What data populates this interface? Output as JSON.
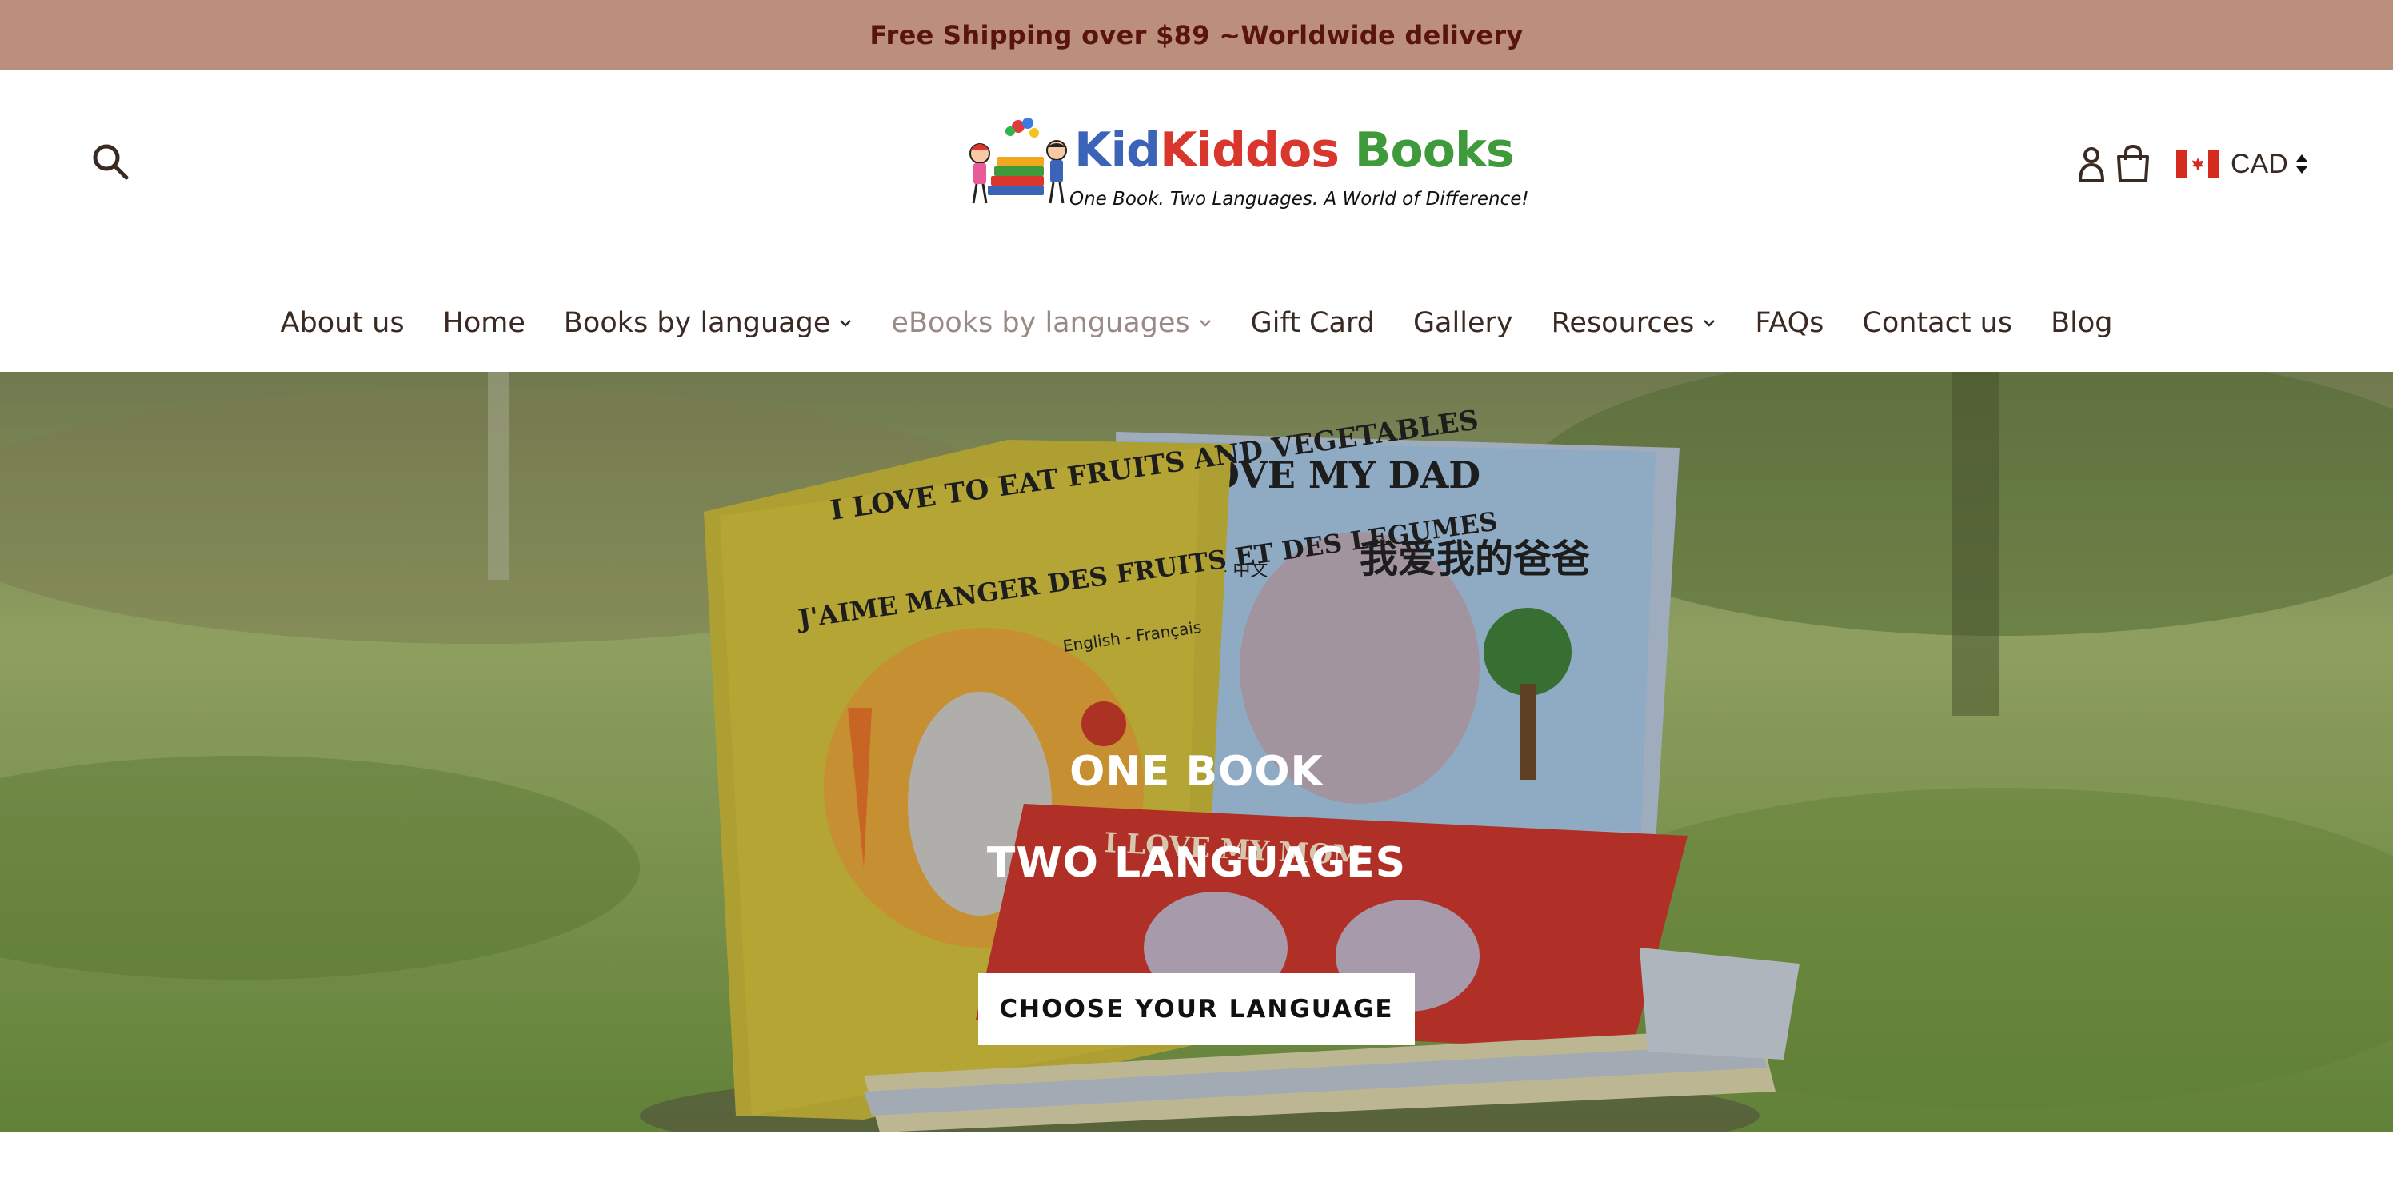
{
  "announcement": {
    "text": "Free Shipping over $89 ~Worldwide delivery"
  },
  "header": {
    "logo": {
      "title_part1": "Kid",
      "title_part2": "Kiddos",
      "title_part3": " Books",
      "tagline": "One Book. Two Languages. A World of Difference!"
    },
    "currency": {
      "code": "CAD",
      "flag": "canada-flag-icon"
    },
    "icons": {
      "search": "search-icon",
      "account": "user-icon",
      "cart": "shopping-bag-icon"
    }
  },
  "nav": {
    "items": [
      {
        "label": "About us",
        "dropdown": false
      },
      {
        "label": "Home",
        "dropdown": false
      },
      {
        "label": "Books by language",
        "dropdown": true
      },
      {
        "label": "eBooks by languages",
        "dropdown": true
      },
      {
        "label": "Gift Card",
        "dropdown": false
      },
      {
        "label": "Gallery",
        "dropdown": false
      },
      {
        "label": "Resources",
        "dropdown": true
      },
      {
        "label": "FAQs",
        "dropdown": false
      },
      {
        "label": "Contact us",
        "dropdown": false
      },
      {
        "label": "Blog",
        "dropdown": false
      }
    ]
  },
  "hero": {
    "line1": "ONE BOOK",
    "line2": "TWO LANGUAGES",
    "cta": "CHOOSE YOUR LANGUAGE",
    "book_covers": {
      "book1_title": "I LOVE TO EAT FRUITS AND VEGETABLES",
      "book1_subtitle": "J'AIME MANGER DES FRUITS ET DES LEGUMES",
      "book1_langs": "English - Français",
      "book2_title": "I LOVE MY DAD",
      "book2_subtitle": "我爱我的爸爸",
      "book2_langs": "English - 中文",
      "book3_title": "I LOVE MY MOM"
    }
  },
  "colors": {
    "announce_bg": "#bb8f7c",
    "announce_text": "#5a1410",
    "nav_text": "#3a2a22",
    "nav_muted": "#9a8a84"
  }
}
